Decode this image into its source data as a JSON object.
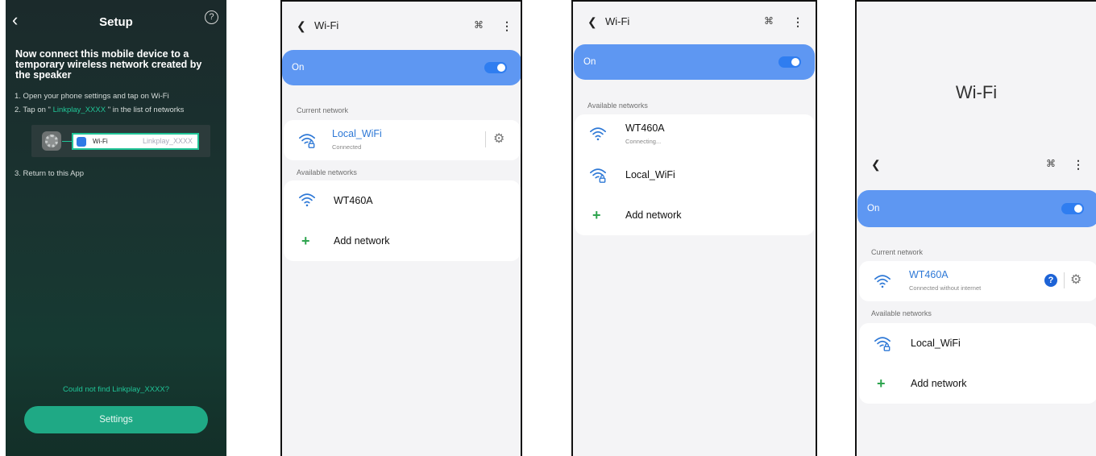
{
  "setup": {
    "back_glyph": "‹",
    "title": "Setup",
    "help_glyph": "?",
    "heading": "Now connect this mobile device to a temporary wireless network created by the speaker",
    "step1": "1. Open your phone settings and tap on Wi-Fi",
    "step2_prefix": "2. Tap on \"",
    "step2_network": " Linkplay_XXXX ",
    "step2_suffix": "\" in the list of networks",
    "illustration": {
      "wifi_label": "Wi-Fi",
      "network": "Linkplay_XXXX",
      "icon": "settings-app-icon"
    },
    "step3": "3. Return to this App",
    "not_found": "Could not find Linkplay_XXXX?",
    "settings_button": "Settings",
    "colors": {
      "accent": "#20c497",
      "button": "#1fa985"
    }
  },
  "wifi_current": {
    "title": "Wi-Fi",
    "on_label": "On",
    "toggle_on": true,
    "current_section": "Current network",
    "current": {
      "name": "Local_WiFi",
      "status": "Connected",
      "icon": "wifi-lock-icon"
    },
    "available_section": "Available networks",
    "available": [
      {
        "name": "WT460A",
        "icon": "wifi-icon"
      }
    ],
    "add_network": "Add network"
  },
  "wifi_connecting": {
    "title": "Wi-Fi",
    "on_label": "On",
    "toggle_on": true,
    "available_section": "Available networks",
    "available": [
      {
        "name": "WT460A",
        "status": "Connecting...",
        "icon": "wifi-icon"
      },
      {
        "name": "Local_WiFi",
        "icon": "wifi-lock-icon"
      }
    ],
    "add_network": "Add network"
  },
  "wifi_connected_no_internet": {
    "big_title": "Wi-Fi",
    "on_label": "On",
    "toggle_on": true,
    "current_section": "Current network",
    "current": {
      "name": "WT460A",
      "status": "Connected without internet",
      "icon": "wifi-icon"
    },
    "available_section": "Available networks",
    "available": [
      {
        "name": "Local_WiFi",
        "icon": "wifi-lock-icon"
      }
    ],
    "add_network": "Add network",
    "colors": {
      "accent": "#2d78d6",
      "on_bar": "#5e97f2"
    }
  }
}
